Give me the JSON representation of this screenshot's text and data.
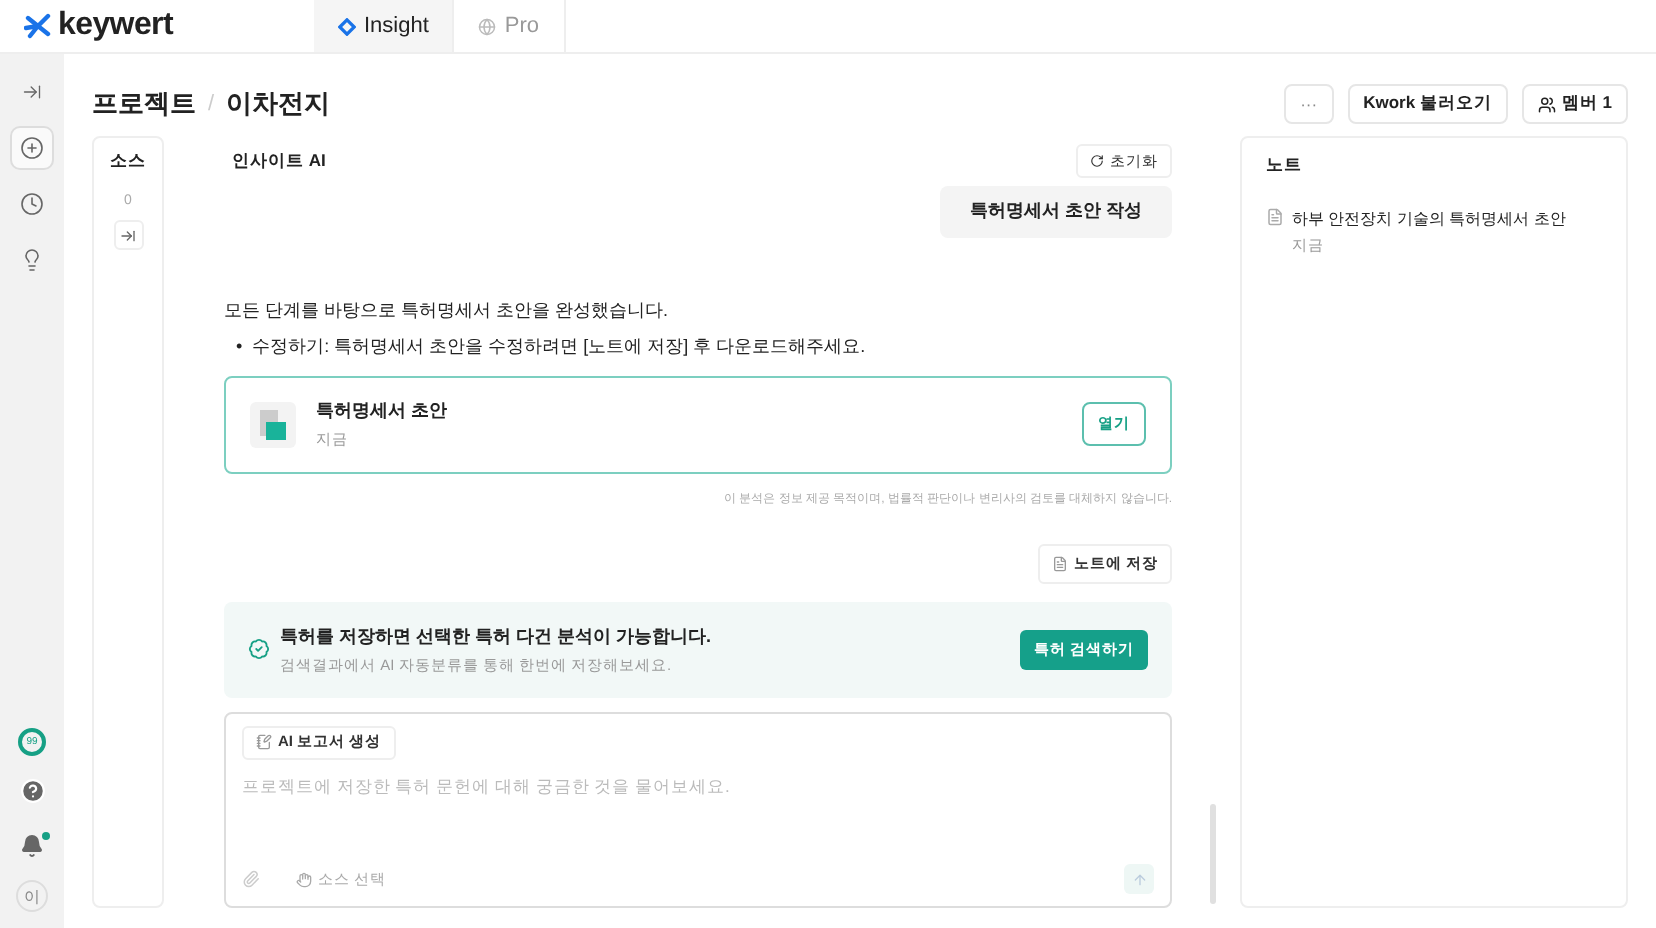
{
  "brand": {
    "name": "keywert"
  },
  "tabs": [
    {
      "label": "Insight",
      "selected": true
    },
    {
      "label": "Pro",
      "selected": false
    }
  ],
  "rail": {
    "credits": "99",
    "notifications_unread": true,
    "avatar": "이"
  },
  "breadcrumb": [
    "프로젝트",
    "이차전지"
  ],
  "breadcrumb_separator": "/",
  "header_actions": {
    "more": "···",
    "import": "Kwork 불러오기",
    "members": "멤버 1"
  },
  "sources": {
    "title": "소스",
    "count": "0"
  },
  "chat": {
    "title": "인사이트 AI",
    "reset": "초기화",
    "user_message": "특허명세서 초안 작성",
    "answer": "모든 단계를 바탕으로 특허명세서 초안을 완성했습니다.",
    "bullets": [
      {
        "marker": "•",
        "text": "수정하기: 특허명세서 초안을 수정하려면 [노트에 저장] 후 다운로드해주세요."
      }
    ],
    "document": {
      "title": "특허명세서 초안",
      "time": "지금",
      "open": "열기"
    },
    "disclaimer": "이 분석은 정보 제공 목적이며, 법률적 판단이나 변리사의 검토를 대체하지 않습니다.",
    "save": "노트에 저장",
    "tip": {
      "title": "특허를 저장하면 선택한 특허 다건 분석이 가능합니다.",
      "subtitle": "검색결과에서 AI 자동분류를 통해 한번에 저장해보세요.",
      "action": "특허 검색하기"
    },
    "composer": {
      "report": "AI 보고서 생성",
      "placeholder": "프로젝트에 저장한 특허 문헌에 대해 궁금한 것을 물어보세요.",
      "source_select": "소스 선택"
    }
  },
  "notes": {
    "title": "노트",
    "items": [
      {
        "title": "하부 안전장치 기술의 특허명세서 초안",
        "time": "지금"
      }
    ]
  }
}
